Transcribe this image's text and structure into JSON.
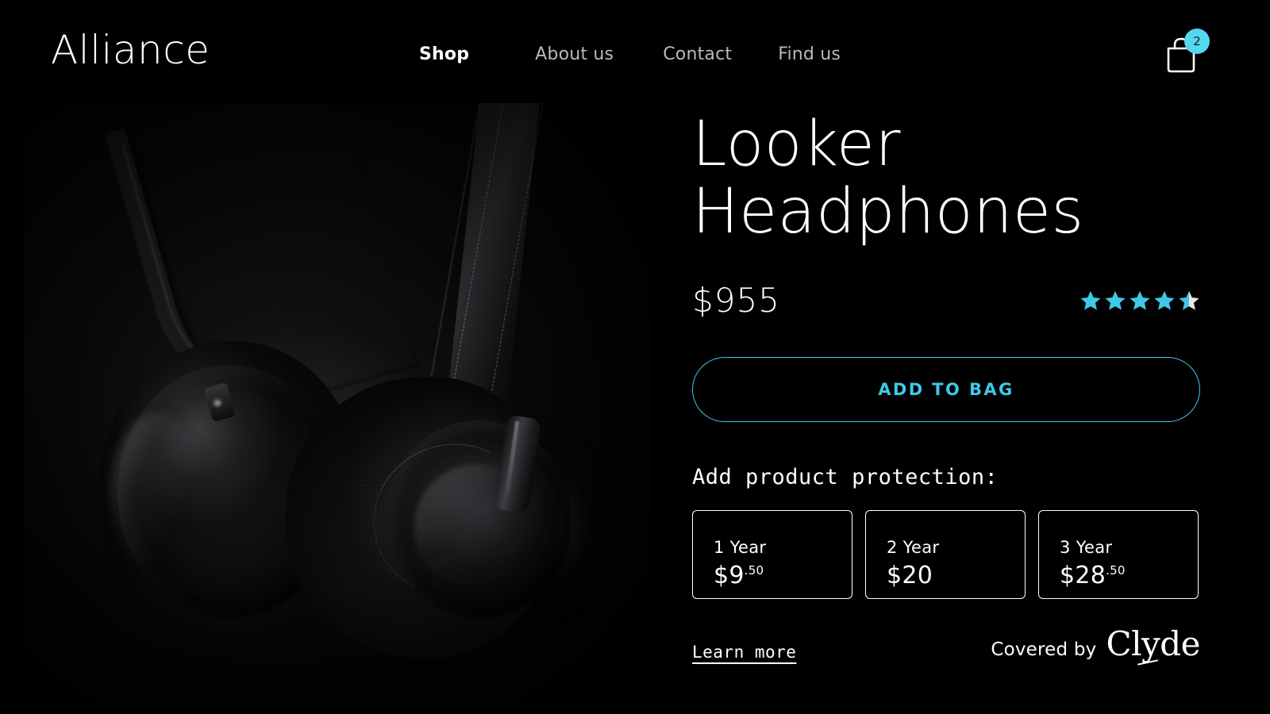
{
  "header": {
    "brand": "Alliance",
    "nav": [
      {
        "label": "Shop",
        "active": true
      },
      {
        "label": "About us",
        "active": false
      },
      {
        "label": "Contact",
        "active": false
      },
      {
        "label": "Find us",
        "active": false
      }
    ],
    "cart": {
      "icon": "shopping-bag-icon",
      "count": "2"
    }
  },
  "product": {
    "image_alt": "Black over-ear Looker headphones on dark background",
    "title": "Looker\nHeadphones",
    "price": "$955",
    "rating": {
      "value": 4.5,
      "max": 5,
      "full_stars": 4,
      "half_star": true
    },
    "add_to_bag_label": "ADD TO BAG"
  },
  "protection": {
    "heading": "Add product protection:",
    "plans": [
      {
        "term": "1 Year",
        "price": "$9",
        "cents": ".50"
      },
      {
        "term": "2 Year",
        "price": "$20",
        "cents": ""
      },
      {
        "term": "3 Year",
        "price": "$28",
        "cents": ".50"
      }
    ],
    "learn_more_label": "Learn more",
    "covered_by_label": "Covered by",
    "provider": "Clyde"
  },
  "colors": {
    "background": "#000000",
    "accent_cyan": "#3fc9e6",
    "badge_cyan": "#55d8ef",
    "text_primary": "#ffffff",
    "text_muted": "#b9b9b9"
  }
}
